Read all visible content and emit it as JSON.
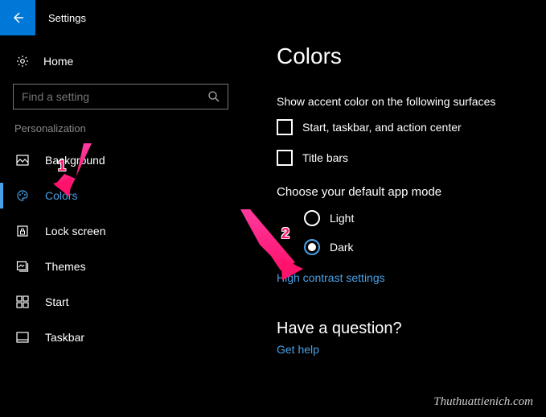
{
  "header": {
    "title": "Settings"
  },
  "sidebar": {
    "home_label": "Home",
    "search_placeholder": "Find a setting",
    "category_label": "Personalization",
    "items": [
      {
        "label": "Background"
      },
      {
        "label": "Colors"
      },
      {
        "label": "Lock screen"
      },
      {
        "label": "Themes"
      },
      {
        "label": "Start"
      },
      {
        "label": "Taskbar"
      }
    ]
  },
  "content": {
    "heading": "Colors",
    "accent_section_label": "Show accent color on the following surfaces",
    "checkbox1_label": "Start, taskbar, and action center",
    "checkbox2_label": "Title bars",
    "app_mode_label": "Choose your default app mode",
    "radio_light": "Light",
    "radio_dark": "Dark",
    "high_contrast_link": "High contrast settings",
    "question_heading": "Have a question?",
    "get_help_link": "Get help"
  },
  "annotations": {
    "num1": "1",
    "num2": "2"
  },
  "watermark": "Thuthuattienich.com"
}
